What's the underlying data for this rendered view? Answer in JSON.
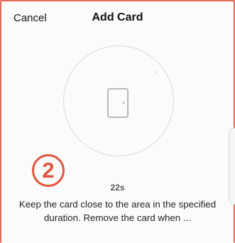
{
  "header": {
    "cancel_label": "Cancel",
    "title": "Add Card"
  },
  "main": {
    "icon": "door-icon",
    "step_marker": "2",
    "timer": "22s",
    "instruction": "Keep the card close to the area in the specified duration. Remove the card when ..."
  },
  "colors": {
    "accent": "#e2563f",
    "frame": "#e66a5a",
    "ring": "#d9d9d9"
  }
}
